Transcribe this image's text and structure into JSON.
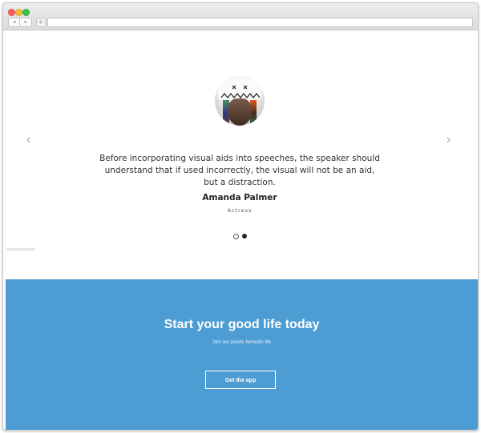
{
  "browser": {
    "nav_back": "◂",
    "nav_forward": "▸",
    "new_tab": "+"
  },
  "testimonial": {
    "quote": "Before incorporating visual aids into speeches, the speaker should understand that if used incorrectly, the visual will not be an aid, but a distraction.",
    "author": "Amanda Palmer",
    "role": "Actress",
    "prev_arrow": "‹",
    "next_arrow": "›",
    "slide_count": 2,
    "active_slide": 2
  },
  "cta": {
    "title": "Start your good life today",
    "subtitle": "Join our plastic fantastic life",
    "button_label": "Get the app",
    "background_color": "#4d9cd4"
  }
}
